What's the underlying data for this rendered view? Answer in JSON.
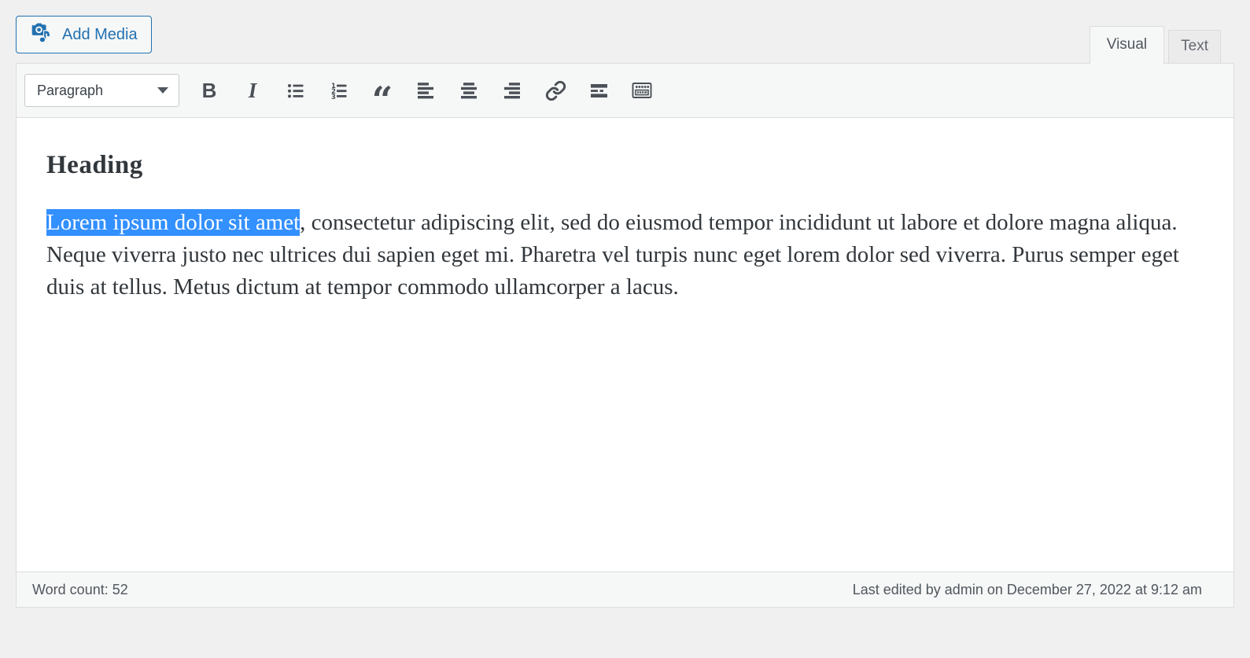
{
  "colors": {
    "page_background": "#f0f0f1",
    "accent_blue": "#2271b1",
    "selection_blue": "#3390ff",
    "toolbar_background": "#f6f7f7",
    "border": "#dcdcde",
    "icon": "#50575e"
  },
  "media_button": {
    "label": "Add Media",
    "icon": "media-icon"
  },
  "tabs": [
    {
      "label": "Visual",
      "active": true
    },
    {
      "label": "Text",
      "active": false
    }
  ],
  "toolbar": {
    "format_select": {
      "value": "Paragraph",
      "icon": "chevron-down-icon"
    },
    "bold_glyph": "B",
    "italic_glyph": "I",
    "blockquote_glyph": "“",
    "buttons": [
      {
        "name": "bold"
      },
      {
        "name": "italic"
      },
      {
        "name": "bulleted-list"
      },
      {
        "name": "numbered-list"
      },
      {
        "name": "blockquote"
      },
      {
        "name": "align-left"
      },
      {
        "name": "align-center"
      },
      {
        "name": "align-right"
      },
      {
        "name": "insert-link"
      },
      {
        "name": "read-more-tag"
      },
      {
        "name": "toolbar-toggle"
      }
    ]
  },
  "content": {
    "heading": "Heading",
    "paragraph_selected": "Lorem ipsum dolor sit amet",
    "paragraph_rest": ", consectetur adipiscing elit, sed do eiusmod tempor incididunt ut labore et dolore magna aliqua. Neque viverra justo nec ultrices dui sapien eget mi. Pharetra vel turpis nunc eget lorem dolor sed viverra. Purus semper eget duis at tellus. Metus dictum at tempor commodo ullamcorper a lacus."
  },
  "statusbar": {
    "word_count": "Word count: 52",
    "last_edited": "Last edited by admin on December 27, 2022 at 9:12 am"
  }
}
